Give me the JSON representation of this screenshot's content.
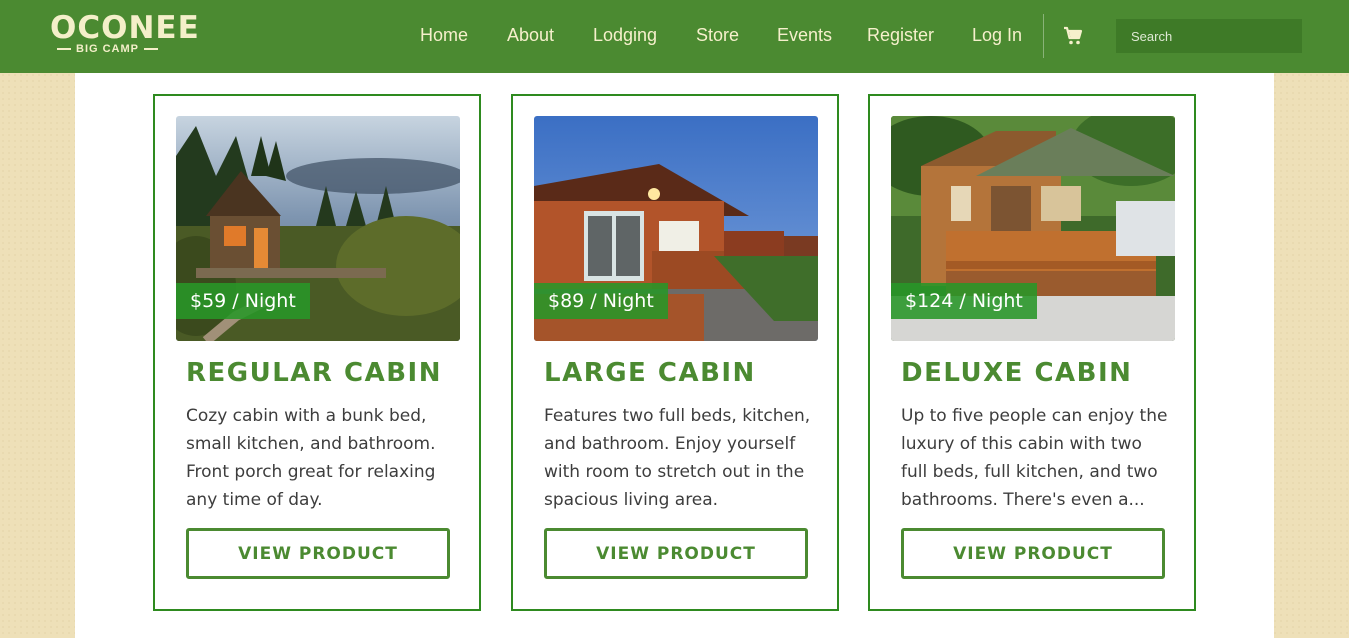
{
  "brand": {
    "name": "OCONEE",
    "tagline": "BIG CAMP"
  },
  "nav": {
    "items": [
      "Home",
      "About",
      "Lodging",
      "Store",
      "Events",
      "Register",
      "Log In"
    ]
  },
  "search": {
    "placeholder": "Search"
  },
  "icons": {
    "cart": "shopping-cart-icon"
  },
  "colors": {
    "header": "#4b8a31",
    "accent": "#2e8a1f",
    "background": "#eee0b8"
  },
  "products": [
    {
      "price": "$59 / Night",
      "title": "REGULAR CABIN",
      "description": "Cozy cabin with a bunk bed, small kitchen, and bathroom. Front porch great for relaxing any time of day.",
      "button": "VIEW PRODUCT"
    },
    {
      "price": "$89 / Night",
      "title": "LARGE CABIN",
      "description": "Features two full beds, kitchen, and bathroom. Enjoy yourself with room to stretch out in the spacious living area.",
      "button": "VIEW PRODUCT"
    },
    {
      "price": "$124 / Night",
      "title": "DELUXE CABIN",
      "description": "Up to five people can enjoy the luxury of this cabin with two full beds, full kitchen, and two bathrooms. There's even a...",
      "button": "VIEW PRODUCT"
    }
  ]
}
